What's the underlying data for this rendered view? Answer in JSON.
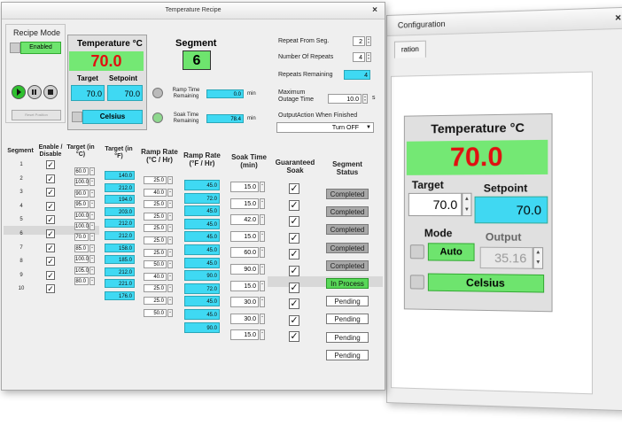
{
  "back_window": {
    "title": "Configuration",
    "close": "×",
    "tab": "ration",
    "temp_title": "Temperature  °C",
    "temp_value": "70.0",
    "target_label": "Target",
    "target_value": "70.0",
    "setpoint_label": "Setpoint",
    "setpoint_value": "70.0",
    "mode_label": "Mode",
    "mode_value": "Auto",
    "output_label": "Output",
    "output_value": "35.16",
    "units_value": "Celsius"
  },
  "front_window": {
    "title": "Temperature Recipe",
    "close": "×",
    "recipe_mode_label": "Recipe Mode",
    "enabled_label": "Enabled",
    "reset_label": "Reset Position",
    "temp_title": "Temperature  °C",
    "temp_value": "70.0",
    "target_label": "Target",
    "target_value": "70.0",
    "setpoint_label": "Setpoint",
    "setpoint_value": "70.0",
    "units_value": "Celsius",
    "segment_label": "Segment",
    "segment_value": "6",
    "ramp_time_label": "Ramp Time Remaining",
    "ramp_time_value": "0.0",
    "ramp_time_unit": "min",
    "soak_time_label": "Soak Time Remaining",
    "soak_time_value": "78.4",
    "soak_time_unit": "min",
    "repeat_from_label": "Repeat From Seg.",
    "repeat_from_value": "2",
    "num_repeats_label": "Number Of Repeats",
    "num_repeats_value": "4",
    "repeats_remaining_label": "Repeats Remaining",
    "repeats_remaining_value": "4",
    "max_outage_label": "Maximum Outage Time",
    "max_outage_value": "10.0",
    "max_outage_unit": "s",
    "output_action_label": "OutputAction When Finished",
    "output_action_value": "Turn OFF",
    "headers": {
      "segment": "Segment",
      "enable": "Enable / Disable",
      "target_c": "Target (in °C)",
      "target_f": "Target (in °F)",
      "ramp_c": "Ramp Rate (°C / Hr)",
      "ramp_f": "Ramp Rate (°F / Hr)",
      "soak": "Soak Time (min)",
      "guaranteed": "Guaranteed Soak",
      "status": "Segment Status"
    },
    "segments": [
      "1",
      "2",
      "3",
      "4",
      "5",
      "6",
      "7",
      "8",
      "9",
      "10"
    ],
    "target_c": [
      "60.0",
      "100.0",
      "90.0",
      "95.0",
      "100.0",
      "100.0",
      "70.0",
      "85.0",
      "100.0",
      "105.0",
      "80.0"
    ],
    "target_f": [
      "140.0",
      "212.0",
      "194.0",
      "203.0",
      "212.0",
      "212.0",
      "158.0",
      "185.0",
      "212.0",
      "221.0",
      "176.0"
    ],
    "ramp_c": [
      "25.0",
      "40.0",
      "25.0",
      "25.0",
      "25.0",
      "25.0",
      "25.0",
      "50.0",
      "40.0",
      "25.0",
      "25.0",
      "50.0"
    ],
    "ramp_f": [
      "45.0",
      "72.0",
      "45.0",
      "45.0",
      "45.0",
      "45.0",
      "45.0",
      "90.0",
      "72.0",
      "45.0",
      "45.0",
      "90.0"
    ],
    "soak": [
      "15.0",
      "15.0",
      "42.0",
      "15.0",
      "60.0",
      "90.0",
      "15.0",
      "30.0",
      "30.0",
      "15.0"
    ],
    "status": [
      "Completed",
      "Completed",
      "Completed",
      "Completed",
      "Completed",
      "In Process",
      "Pending",
      "Pending",
      "Pending",
      "Pending"
    ],
    "check": "✓"
  }
}
